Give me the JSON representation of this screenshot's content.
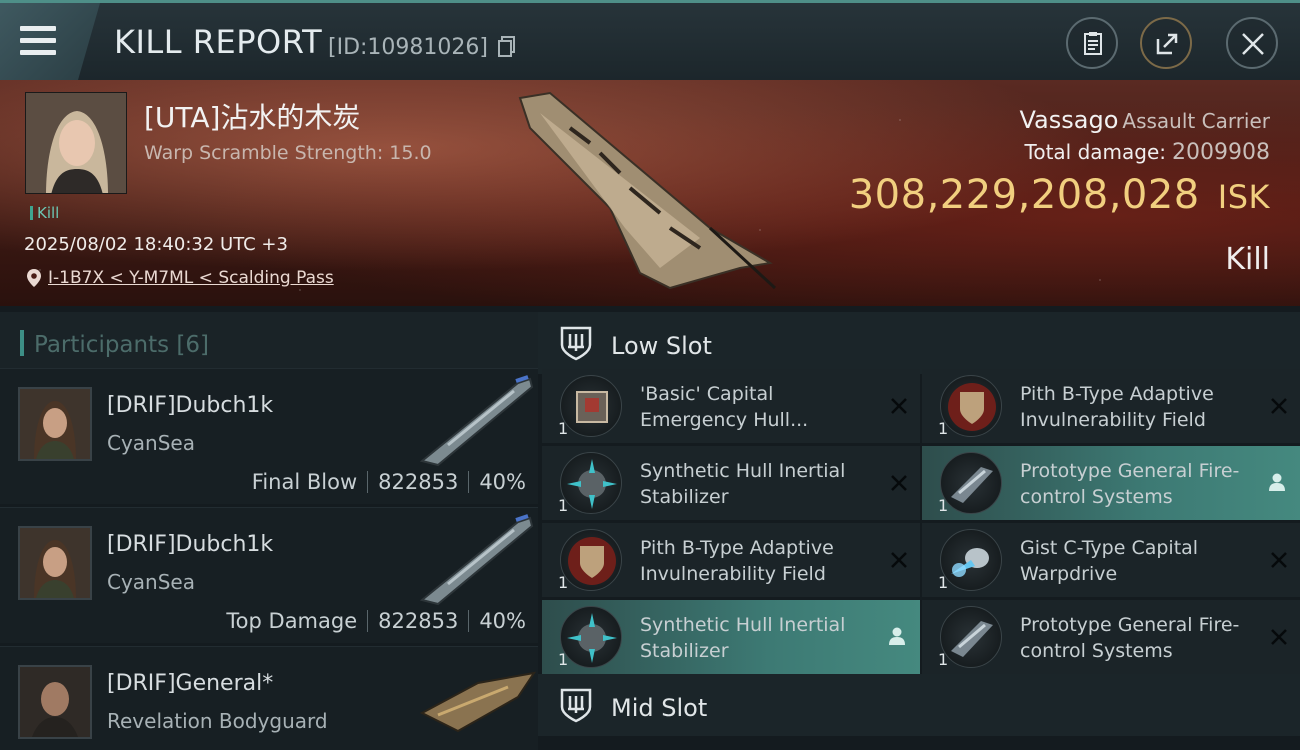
{
  "header": {
    "title": "KILL REPORT",
    "report_id": "[ID:10981026]"
  },
  "victim": {
    "name": "[UTA]沾水的木炭",
    "warp_scramble": "Warp Scramble Strength: 15.0",
    "tag": "Kill",
    "timestamp": "2025/08/02 18:40:32 UTC +3",
    "location": "I-1B7X < Y-M7ML < Scalding Pass"
  },
  "ship": {
    "name": "Vassago",
    "class": "Assault Carrier",
    "total_damage_label": "Total damage:",
    "total_damage": "2009908",
    "isk_value": "308,229,208,028",
    "isk_unit": "ISK",
    "result": "Kill"
  },
  "participants": {
    "label": "Participants [6]",
    "rows": [
      {
        "name": "[DRIF]Dubch1k",
        "ship": "CyanSea",
        "role": "Final Blow",
        "damage": "822853",
        "percent": "40%"
      },
      {
        "name": "[DRIF]Dubch1k",
        "ship": "CyanSea",
        "role": "Top Damage",
        "damage": "822853",
        "percent": "40%"
      },
      {
        "name": "[DRIF]General*",
        "ship": "Revelation Bodyguard"
      }
    ]
  },
  "slots": {
    "low_slot_label": "Low Slot",
    "mid_slot_label": "Mid Slot",
    "modules": [
      {
        "qty": "1",
        "name": "'Basic' Capital Emergency Hull..."
      },
      {
        "qty": "1",
        "name": "Pith B-Type Adaptive Invulnerability Field"
      },
      {
        "qty": "1",
        "name": "Synthetic Hull Inertial Stabilizer"
      },
      {
        "qty": "1",
        "name": "Prototype General Fire-control Systems"
      },
      {
        "qty": "1",
        "name": "Pith B-Type Adaptive Invulnerability Field"
      },
      {
        "qty": "1",
        "name": "Gist C-Type Capital Warpdrive"
      },
      {
        "qty": "1",
        "name": "Synthetic Hull Inertial Stabilizer"
      },
      {
        "qty": "1",
        "name": "Prototype General Fire-control Systems"
      }
    ]
  },
  "colors": {
    "accent": "#3d8f86",
    "isk_gold": "#f1cf7f",
    "highlight": "#3d7a74"
  }
}
